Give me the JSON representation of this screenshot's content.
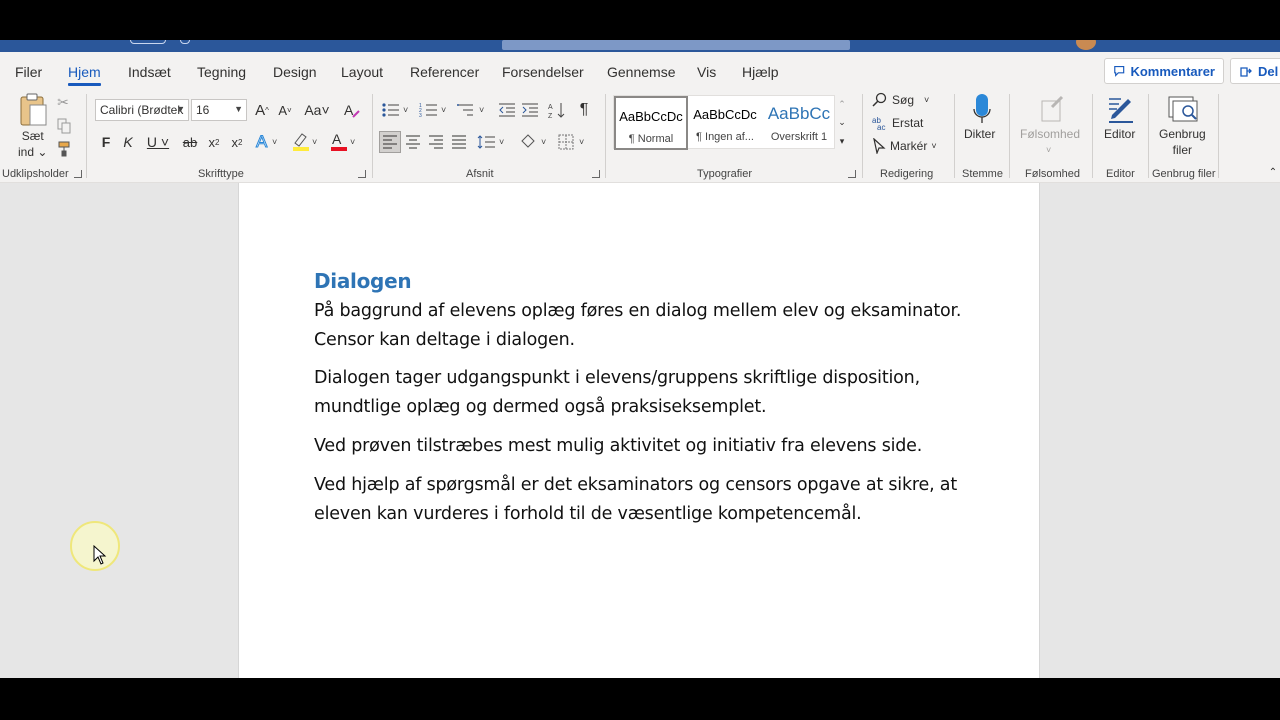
{
  "ribbon_tabs": [
    "Filer",
    "Hjem",
    "Indsæt",
    "Tegning",
    "Design",
    "Layout",
    "Referencer",
    "Forsendelser",
    "Gennemse",
    "Vis",
    "Hjælp"
  ],
  "active_tab": "Hjem",
  "top_buttons": {
    "comments": "Kommentarer",
    "share": "Del"
  },
  "clipboard": {
    "paste_label_1": "Sæt",
    "paste_label_2": "ind",
    "group": "Udklipsholder"
  },
  "font": {
    "name": "Calibri (Brødtek",
    "size": "16",
    "group": "Skrifttype",
    "bold": "F",
    "italic": "K",
    "underline": "U",
    "strike": "ab",
    "change_case": "Aa"
  },
  "paragraph": {
    "group": "Afsnit"
  },
  "styles": {
    "group": "Typografier",
    "items": [
      {
        "preview": "AaBbCcDc",
        "name": "¶ Normal"
      },
      {
        "preview": "AaBbCcDc",
        "name": "¶ Ingen af..."
      },
      {
        "preview": "AaBbCc",
        "name": "Overskrift 1"
      }
    ]
  },
  "editing": {
    "group": "Redigering",
    "find": "Søg",
    "replace": "Erstat",
    "select": "Markér"
  },
  "voice": {
    "label": "Dikter",
    "group": "Stemme"
  },
  "sensitivity": {
    "label": "Følsomhed",
    "group": "Følsomhed"
  },
  "editor": {
    "label": "Editor",
    "group": "Editor"
  },
  "reuse": {
    "label_1": "Genbrug",
    "label_2": "filer",
    "group": "Genbrug filer"
  },
  "document": {
    "heading": "Dialogen",
    "paragraphs": [
      "På baggrund af elevens oplæg føres en dialog mellem elev og eksaminator. Censor kan deltage i dialogen.",
      "Dialogen tager udgangspunkt i elevens/gruppens skriftlige disposition, mundtlige oplæg og dermed også praksiseksemplet.",
      "Ved prøven tilstræbes mest mulig aktivitet og initiativ fra elevens side.",
      "Ved hjælp af spørgsmål er det eksaminators og censors opgave at sikre, at eleven kan vurderes i forhold til de væsentlige kompetencemål."
    ]
  },
  "colors": {
    "accent": "#185abd",
    "heading": "#2e74b5",
    "titlebar": "#2b579a"
  }
}
